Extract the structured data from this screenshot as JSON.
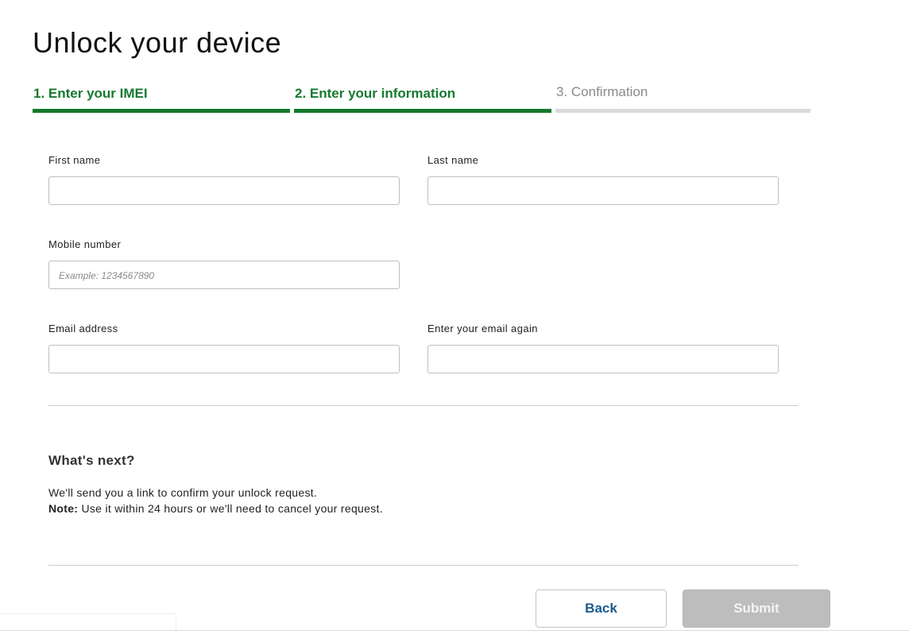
{
  "page": {
    "title": "Unlock your device"
  },
  "steps": [
    {
      "label": "1. Enter your IMEI",
      "state": "completed"
    },
    {
      "label": "2. Enter your information",
      "state": "current"
    },
    {
      "label": "3. Confirmation",
      "state": "upcoming"
    }
  ],
  "form": {
    "first_name": {
      "label": "First name",
      "value": "",
      "placeholder": ""
    },
    "last_name": {
      "label": "Last name",
      "value": "",
      "placeholder": ""
    },
    "mobile_number": {
      "label": "Mobile number",
      "value": "",
      "placeholder": "Example: 1234567890"
    },
    "email": {
      "label": "Email address",
      "value": "",
      "placeholder": ""
    },
    "email_confirm": {
      "label": "Enter your email again",
      "value": "",
      "placeholder": ""
    }
  },
  "whats_next": {
    "title": "What's next?",
    "line1": "We'll send you a link to confirm your unlock request.",
    "note_label": "Note:",
    "note_text": " Use it within 24 hours or we'll need to cancel your request."
  },
  "buttons": {
    "back": "Back",
    "submit": "Submit"
  },
  "colors": {
    "accent": "#157a2f",
    "inactive_step": "#d9d9d9",
    "link_blue": "#1a5a8e",
    "disabled_button": "#bdbdbd"
  }
}
